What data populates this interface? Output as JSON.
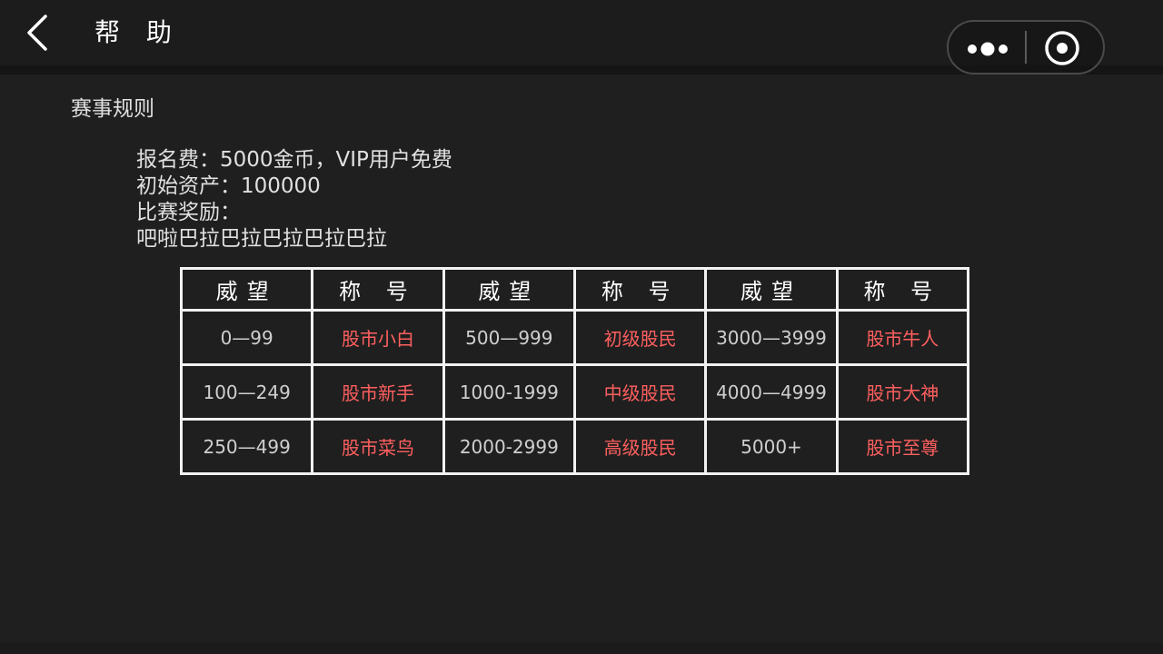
{
  "header": {
    "title": "帮 助"
  },
  "capsule": {
    "more_icon": "more-dots-icon",
    "close_icon": "target-close-icon"
  },
  "section": {
    "title": "赛事规则"
  },
  "rules": {
    "lines": [
      "报名费：5000金币，VIP用户免费",
      "初始资产：100000",
      "比赛奖励：",
      "吧啦巴拉巴拉巴拉巴拉巴拉"
    ]
  },
  "table": {
    "headers": [
      "威望",
      "称 号",
      "威望",
      "称 号",
      "威望",
      "称 号"
    ],
    "rows": [
      [
        "0—99",
        "股市小白",
        "500—999",
        "初级股民",
        "3000—3999",
        "股市牛人"
      ],
      [
        "100—249",
        "股市新手",
        "1000-1999",
        "中级股民",
        "4000—4999",
        "股市大神"
      ],
      [
        "250—499",
        "股市菜鸟",
        "2000-2999",
        "高级股民",
        "5000+",
        "股市至尊"
      ]
    ]
  },
  "colors": {
    "background": "#1b1b1b",
    "text": "#e0e0e0",
    "title_accent": "#ff5f5f",
    "table_border": "#f2f2f2"
  }
}
